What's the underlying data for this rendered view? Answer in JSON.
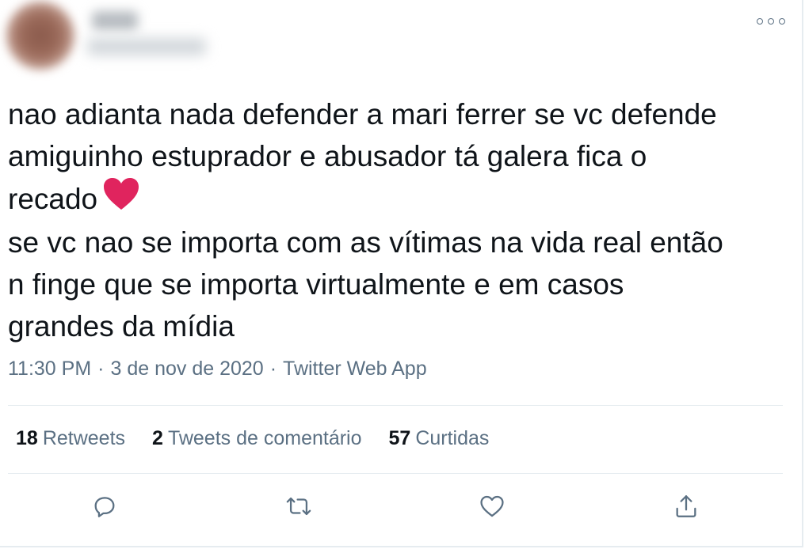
{
  "tweet": {
    "text_lines": [
      "nao adianta nada defender a mari ferrer se vc defende",
      "amiguinho estuprador e abusador tá galera fica o",
      "recado",
      "se vc nao se importa com as vítimas na vida real então",
      "n finge que se importa virtualmente e em casos",
      "grandes da mídia"
    ],
    "emoji": "red-heart",
    "time": "11:30 PM",
    "date": "3 de nov de 2020",
    "source": "Twitter Web App",
    "separator": "·"
  },
  "stats": {
    "retweets_count": "18",
    "retweets_label": "Retweets",
    "quotes_count": "2",
    "quotes_label": "Tweets de comentário",
    "likes_count": "57",
    "likes_label": "Curtidas"
  },
  "icons": [
    "more-icon",
    "reply-icon",
    "retweet-icon",
    "like-icon",
    "share-icon"
  ],
  "colors": {
    "text": "#0f1419",
    "secondary": "#5b7083",
    "divider": "#e6ecf0",
    "heart": "#e0245e"
  }
}
